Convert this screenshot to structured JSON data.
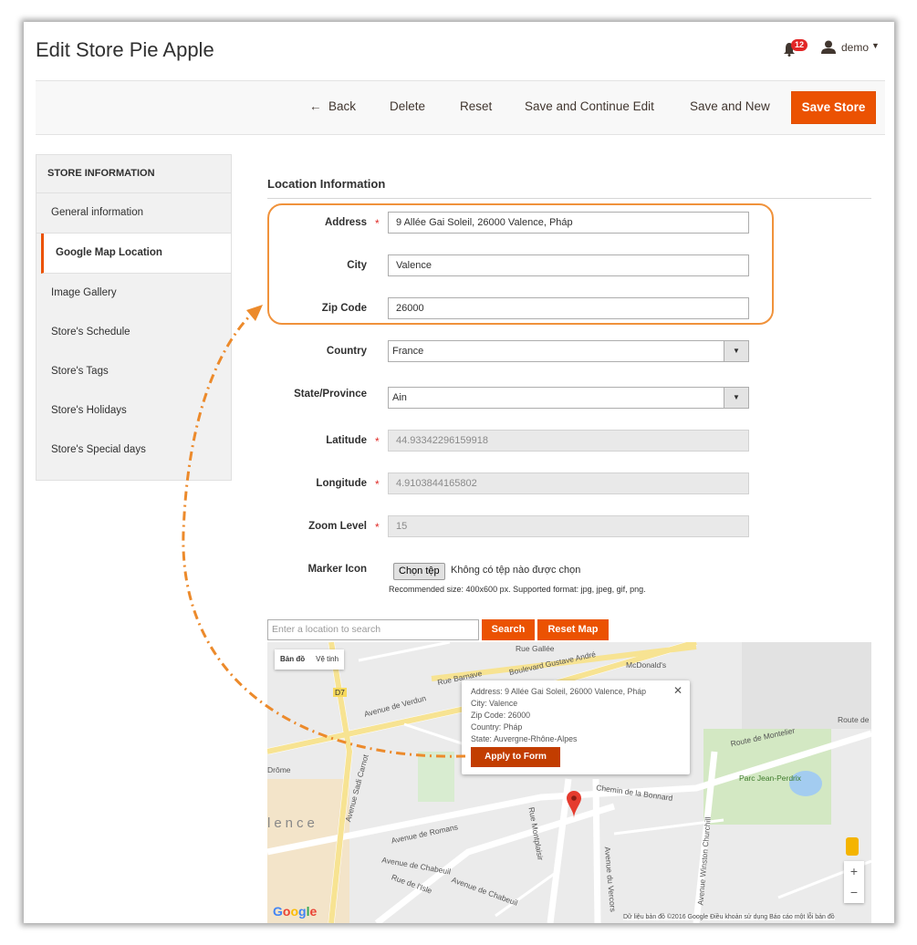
{
  "header": {
    "title": "Edit Store Pie Apple",
    "notifications_count": "12",
    "user_name": "demo"
  },
  "toolbar": {
    "back": "Back",
    "delete": "Delete",
    "reset": "Reset",
    "save_continue": "Save and Continue Edit",
    "save_new": "Save and New",
    "save_store": "Save Store"
  },
  "sidebar": {
    "heading": "STORE INFORMATION",
    "items": [
      {
        "label": "General information"
      },
      {
        "label": "Google Map Location"
      },
      {
        "label": "Image Gallery"
      },
      {
        "label": "Store's Schedule"
      },
      {
        "label": "Store's Tags"
      },
      {
        "label": "Store's Holidays"
      },
      {
        "label": "Store's Special days"
      }
    ]
  },
  "form": {
    "section_title": "Location Information",
    "address_label": "Address",
    "address_value": "9 Allée Gai Soleil, 26000 Valence, Pháp",
    "city_label": "City",
    "city_value": "Valence",
    "zip_label": "Zip Code",
    "zip_value": "26000",
    "country_label": "Country",
    "country_value": "France",
    "state_label": "State/Province",
    "state_value": "Ain",
    "latitude_label": "Latitude",
    "latitude_value": "44.93342296159918",
    "longitude_label": "Longitude",
    "longitude_value": "4.9103844165802",
    "zoom_label": "Zoom Level",
    "zoom_value": "15",
    "marker_label": "Marker Icon",
    "file_button": "Chọn tệp",
    "file_status": "Không có tệp nào được chọn",
    "recommended": "Recommended size: 400x600 px. Supported format: jpg, jpeg, gif, png."
  },
  "map": {
    "search_placeholder": "Enter a location to search",
    "search_button": "Search",
    "reset_button": "Reset Map",
    "tab_map": "Bản đồ",
    "tab_satellite": "Vệ tinh",
    "info_address": "Address: 9 Allée Gai Soleil, 26000 Valence, Pháp",
    "info_city": "City: Valence",
    "info_zip": "Zip Code: 26000",
    "info_country": "Country: Pháp",
    "info_state": "State: Auvergne-Rhône-Alpes",
    "apply_button": "Apply to Form",
    "zoom_in": "+",
    "zoom_out": "−",
    "google": "Google",
    "attribution": "Dữ liệu bản đồ ©2016 Google   Điều khoản sử dụng   Báo cáo một lỗi bản đồ",
    "labels": {
      "boulevard": "Boulevard Gustave André",
      "mcdonalds": "McDonald's",
      "verdun": "Avenue de Verdun",
      "montelier": "Route de Montelier",
      "route_de": "Route de",
      "parc": "Parc Jean-Perdrix",
      "drome": "Drôme",
      "valence": "lence",
      "sadi": "Avenue Sadi Carnot",
      "romans": "Avenue de Romans",
      "chabeuil": "Avenue de Chabeuil",
      "chabeuil2": "Avenue de Chabeuil",
      "isle": "Rue de l'Isle",
      "montplaisir": "Rue Montplaisir",
      "bonnard": "Chemin de la Bonnard",
      "churchill": "Avenue Winston Churchill",
      "vercors": "Avenue du Vercors",
      "galliee": "Rue Gallée",
      "barnave": "Rue Barnave",
      "d7": "D7"
    }
  },
  "colors": {
    "accent": "#eb5202",
    "highlight": "#f0923b"
  }
}
